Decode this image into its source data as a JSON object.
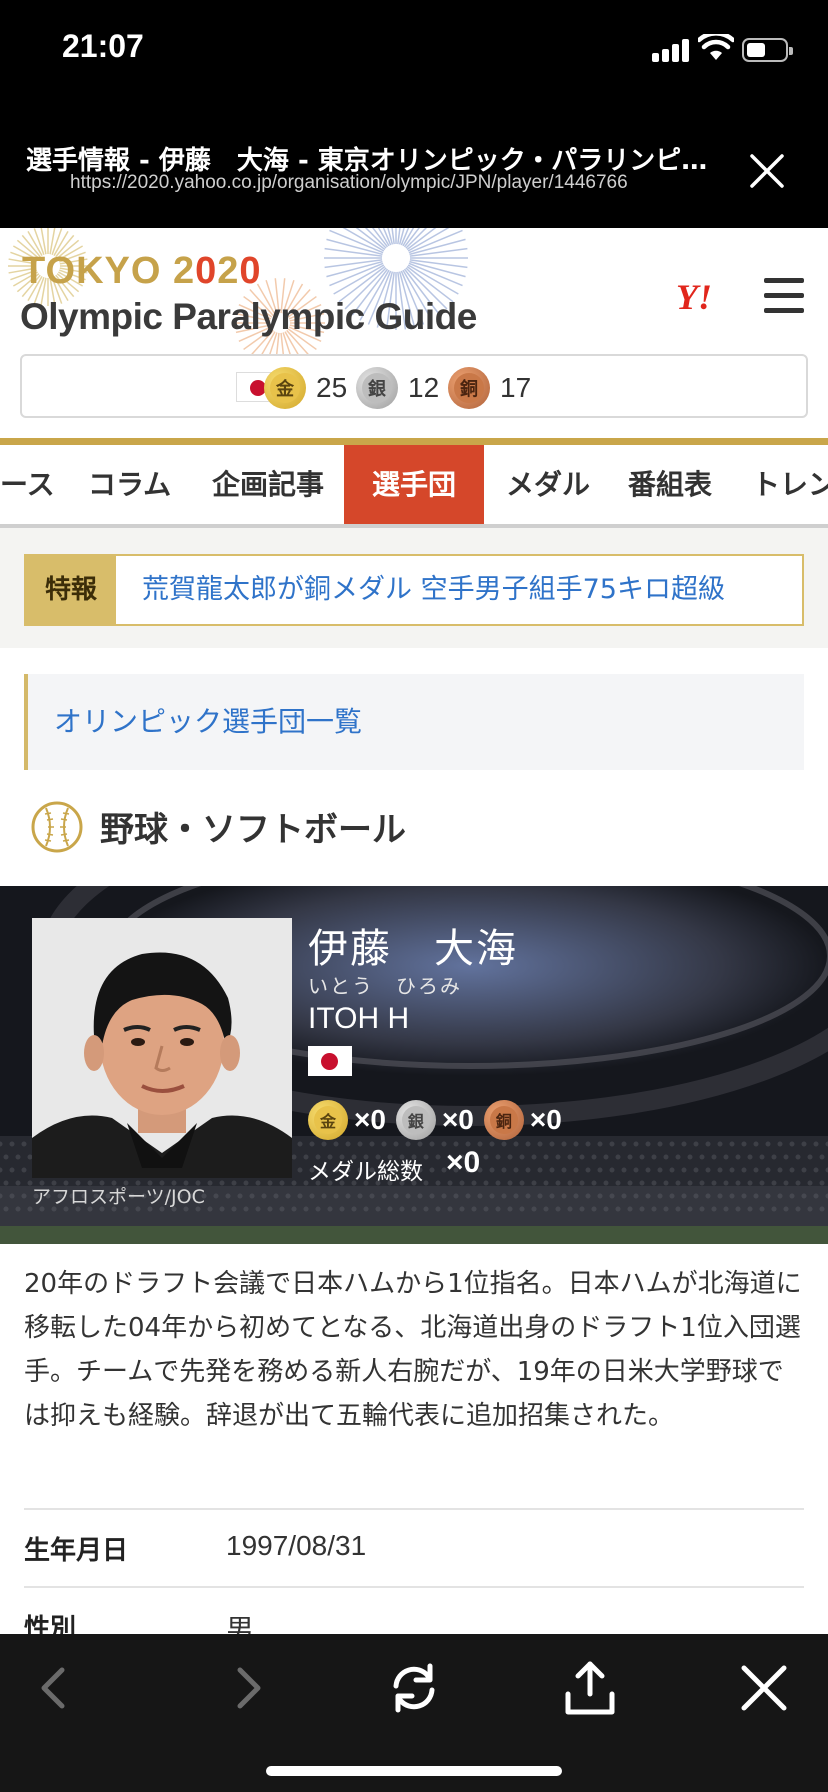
{
  "status_bar": {
    "time": "21:07"
  },
  "browser": {
    "page_title": "選手情報 - 伊藤　大海 - 東京オリンピック・パラリンピック",
    "url": "https://2020.yahoo.co.jp/organisation/olympic/JPN/player/1446766"
  },
  "site": {
    "logo_line1_prefix": "TOKYO 2",
    "logo_line1_o1": "0",
    "logo_line1_mid": "2",
    "logo_line1_o2": "0",
    "logo_line2": "Olympic Paralympic Guide",
    "yahoo_logo": "Y!",
    "medals": {
      "gold_label": "金",
      "gold_count": "25",
      "silver_label": "銀",
      "silver_count": "12",
      "bronze_label": "銅",
      "bronze_count": "17"
    }
  },
  "nav": {
    "tabs": [
      {
        "label": "ース"
      },
      {
        "label": "コラム"
      },
      {
        "label": "企画記事"
      },
      {
        "label": "選手団",
        "active": true
      },
      {
        "label": "メダル"
      },
      {
        "label": "番組表"
      },
      {
        "label": "トレン"
      }
    ]
  },
  "breaking_news": {
    "badge": "特報",
    "text": "荒賀龍太郎が銅メダル 空手男子組手75キロ超級"
  },
  "team_list_link": "オリンピック選手団一覧",
  "sport": {
    "title": "野球・ソフトボール",
    "icon": "baseball-icon"
  },
  "athlete": {
    "name": "伊藤　大海",
    "kana": "いとう　ひろみ",
    "roman": "ITOH H",
    "photo_credit": "アフロスポーツ/JOC",
    "medals": {
      "gold_label": "金",
      "gold": "×0",
      "silver_label": "銀",
      "silver": "×0",
      "bronze_label": "銅",
      "bronze": "×0"
    },
    "medal_total_label": "メダル総数",
    "medal_total": "×0"
  },
  "bio": "20年のドラフト会議で日本ハムから1位指名。日本ハムが北海道に移転した04年から初めてとなる、北海道出身のドラフト1位入団選手。チームで先発を務める新人右腕だが、19年の日米大学野球では抑えも経験。辞退が出て五輪代表に追加招集された。",
  "profile": [
    {
      "label": "生年月日",
      "value": "1997/08/31"
    },
    {
      "label": "性別",
      "value": "男"
    }
  ],
  "toolbar": {
    "icons": [
      "back-icon",
      "forward-icon",
      "reload-icon",
      "share-icon",
      "close-icon"
    ]
  },
  "colors": {
    "accent_gold": "#c9a64a",
    "active_tab": "#d5472a",
    "link_blue": "#2f73c9",
    "yahoo_red": "#e1261c"
  }
}
